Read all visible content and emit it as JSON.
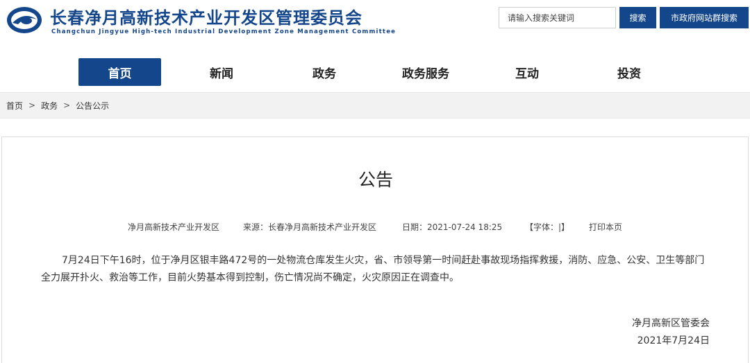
{
  "header": {
    "title": "长春净月高新技术产业开发区管理委员会",
    "subtitle": "Changchun Jingyue High-tech Industrial Development Zone Management  Committee",
    "search_placeholder": "请输入搜索关键词",
    "search_label": "搜索",
    "sitegroup_label": "市政府网站群搜索",
    "brand_color": "#14468c"
  },
  "nav": {
    "items": [
      {
        "label": "首页",
        "active": true
      },
      {
        "label": "新闻",
        "active": false
      },
      {
        "label": "政务",
        "active": false
      },
      {
        "label": "政务服务",
        "active": false
      },
      {
        "label": "互动",
        "active": false
      },
      {
        "label": "投资",
        "active": false
      }
    ]
  },
  "breadcrumb": {
    "items": [
      "首页",
      "政务",
      "公告公示"
    ],
    "separator": ">"
  },
  "article": {
    "title": "公告",
    "meta": {
      "org": "净月高新技术产业开发区",
      "source": "来源：长春净月高新技术产业开发区",
      "date": "日期：2021-07-24 18:25",
      "fontsize": "【字体：|】",
      "print": "打印本页"
    },
    "body": "7月24日下午16时，位于净月区银丰路472号的一处物流仓库发生火灾，省、市领导第一时间赶赴事故现场指挥救援，消防、应急、公安、卫生等部门全力展开扑火、救治等工作，目前火势基本得到控制，伤亡情况尚不确定，火灾原因正在调查中。",
    "sign_org": "净月高新区管委会",
    "sign_date": "2021年7月24日"
  }
}
